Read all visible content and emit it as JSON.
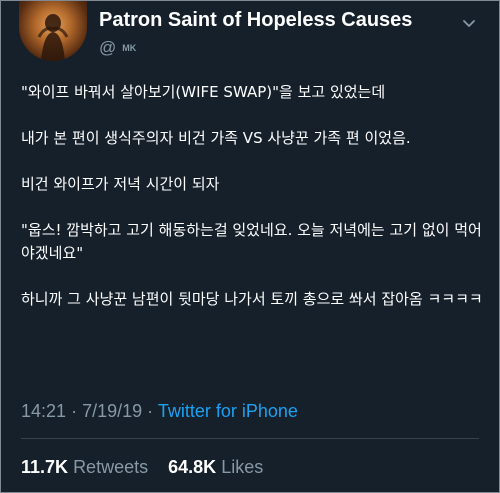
{
  "tweet": {
    "display_name": "Patron Saint of Hopeless Causes",
    "handle_at": "@",
    "handle": "MK",
    "paragraphs": [
      "\"와이프 바꿔서 살아보기(WIFE SWAP)\"을 보고 있었는데",
      "내가 본 편이 생식주의자 비건 가족 VS 사냥꾼 가족 편 이었음.",
      "비건 와이프가 저녁 시간이 되자",
      "\"웁스! 깜박하고 고기 해동하는걸 잊었네요. 오늘 저녁에는 고기 없이 먹어야겠네요\"",
      "하니까 그 사냥꾼 남편이 뒷마당 나가서 토끼 총으로 쏴서 잡아옴  ㅋㅋㅋㅋ"
    ],
    "time": "14:21",
    "date": "7/19/19",
    "separator": "·",
    "source": "Twitter for iPhone",
    "retweets_count": "11.7K",
    "retweets_label": "Retweets",
    "likes_count": "64.8K",
    "likes_label": "Likes"
  },
  "icons": {
    "avatar": "profile-photo",
    "menu": "chevron-down-icon"
  },
  "colors": {
    "background": "#15202b",
    "text": "#ffffff",
    "muted": "#8899a6",
    "link": "#1da1f2",
    "divider": "#38444d"
  }
}
